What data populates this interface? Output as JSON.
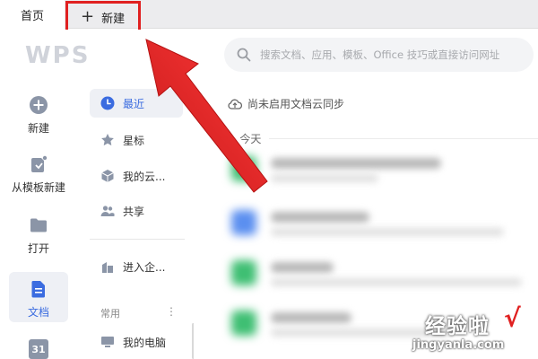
{
  "tabs": {
    "home_label": "首页",
    "new_label": "新建",
    "new_plus": "+"
  },
  "header": {
    "logo": "WPS",
    "search_placeholder": "搜索文档、应用、模板、Office 技巧或直接访问网址"
  },
  "leftnav": {
    "items": [
      {
        "label": "新建",
        "icon": "plus-circle-icon"
      },
      {
        "label": "从模板新建",
        "icon": "template-icon"
      },
      {
        "label": "打开",
        "icon": "folder-icon"
      },
      {
        "label": "文档",
        "icon": "document-icon"
      },
      {
        "label": "31",
        "icon": "calendar-icon"
      }
    ]
  },
  "midpanel": {
    "items": [
      {
        "label": "最近",
        "icon": "clock-icon"
      },
      {
        "label": "星标",
        "icon": "star-icon"
      },
      {
        "label": "我的云...",
        "icon": "cloud-box-icon"
      },
      {
        "label": "共享",
        "icon": "share-users-icon"
      },
      {
        "label": "进入企...",
        "icon": "enterprise-icon"
      }
    ],
    "section_label": "常用",
    "section_dots": "⋮",
    "common_items": [
      {
        "label": "我的电脑",
        "icon": "computer-icon"
      }
    ]
  },
  "content": {
    "sync_text": "尚未启用文档云同步",
    "today_label": "今天",
    "today_chevron": "∨"
  },
  "watermark": {
    "main": "经验啦",
    "check": "√",
    "url": "jingyanla.com"
  },
  "colors": {
    "accent": "#3b6ce0",
    "highlight": "#e02020",
    "nav_active_bg": "#eef0f5"
  }
}
